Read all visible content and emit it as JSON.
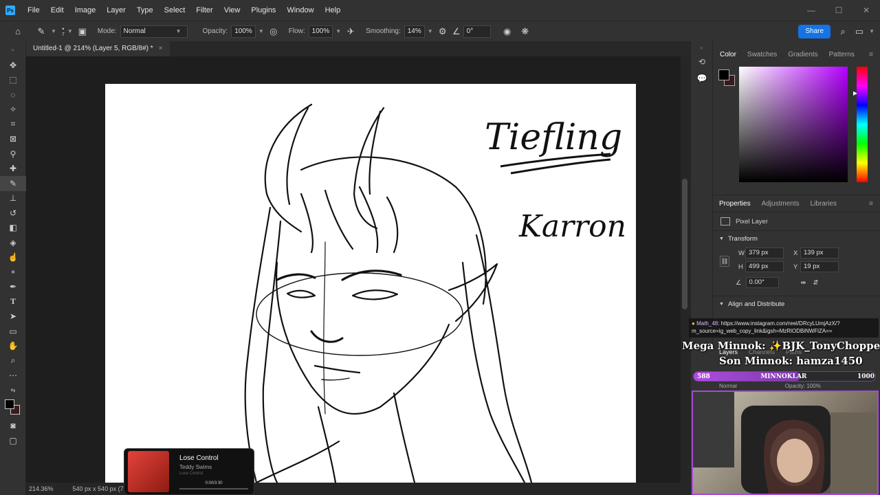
{
  "app": {
    "logo": "Ps"
  },
  "menu": [
    "File",
    "Edit",
    "Image",
    "Layer",
    "Type",
    "Select",
    "Filter",
    "View",
    "Plugins",
    "Window",
    "Help"
  ],
  "options": {
    "brush_size": "7",
    "mode_label": "Mode:",
    "mode_value": "Normal",
    "opacity_label": "Opacity:",
    "opacity_value": "100%",
    "flow_label": "Flow:",
    "flow_value": "100%",
    "smoothing_label": "Smoothing:",
    "smoothing_value": "14%",
    "angle_value": "0°",
    "share_label": "Share"
  },
  "document": {
    "tab_title": "Untitled-1 @ 214% (Layer 5, RGB/8#) *",
    "close_glyph": "×",
    "zoom": "214.36%",
    "doc_size": "540 px x 540 px (72 ppi)"
  },
  "canvas_text": {
    "title": "Tiefling",
    "name": "Karron"
  },
  "panels": {
    "color_tabs": [
      "Color",
      "Swatches",
      "Gradients",
      "Patterns"
    ],
    "fg_color": "#000000",
    "bg_color": "#3a1a1a",
    "properties_tabs": [
      "Properties",
      "Adjustments",
      "Libraries"
    ],
    "layer_type": "Pixel Layer",
    "transform_title": "Transform",
    "w_label": "W",
    "w_value": "379 px",
    "h_label": "H",
    "h_value": "499 px",
    "x_label": "X",
    "x_value": "139 px",
    "y_label": "Y",
    "y_value": "19 px",
    "angle_value": "0.00°",
    "align_title": "Align and Distribute",
    "layers_tabs": [
      "Layers",
      "Channels",
      "Paths"
    ],
    "blend_mode": "Normal",
    "layer_opacity_label": "Opacity:",
    "layer_opacity_value": "100%"
  },
  "stream": {
    "chat_user": "Math_48",
    "chat_message": ": https://www.instagram.com/reel/DRcyLUmjAzX/?m_source=ig_web_copy_link&igsh=MzRlODBiNWFlZA==",
    "mega_label": "Mega Minnok: ✨BJK_TonyChopper✨",
    "son_label": "Son Minnok: hamza1450",
    "goal_current": "588",
    "goal_title": "MINNOKLAR",
    "goal_target": "1000",
    "goal_fraction": 0.588
  },
  "music": {
    "title": "Lose Control",
    "artist": "Teddy Swims",
    "album": "Lose Control",
    "time": "0:00/3:30",
    "progress": 0.0
  }
}
